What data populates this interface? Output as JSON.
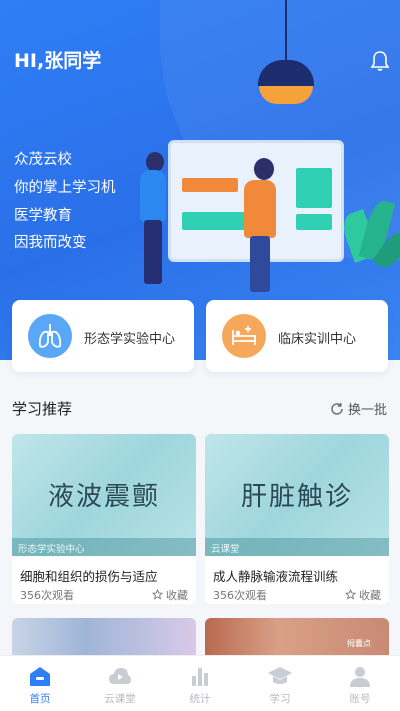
{
  "header": {
    "greeting": "HI,张同学",
    "slogans": [
      "众茂云校",
      "你的掌上学习机",
      "医学教育",
      "因我而改变"
    ]
  },
  "quick_entries": [
    {
      "label": "形态学实验中心",
      "icon": "lungs-icon"
    },
    {
      "label": "临床实训中心",
      "icon": "hospital-bed-icon"
    }
  ],
  "recommend": {
    "title": "学习推荐",
    "refresh_label": "换一批",
    "cards": [
      {
        "thumb_title": "液波震颤",
        "tag": "形态学实验中心",
        "title": "细胞和组织的损伤与适应",
        "views": "356次观看",
        "fav_label": "收藏"
      },
      {
        "thumb_title": "肝脏触诊",
        "tag": "云课堂",
        "title": "成人静脉输液流程训练",
        "views": "356次观看",
        "fav_label": "收藏"
      }
    ],
    "partial_card_text": "拇囊点"
  },
  "tabbar": {
    "items": [
      {
        "label": "首页",
        "icon": "home-icon",
        "active": true
      },
      {
        "label": "云课堂",
        "icon": "cloud-icon",
        "active": false
      },
      {
        "label": "统计",
        "icon": "bar-chart-icon",
        "active": false
      },
      {
        "label": "学习",
        "icon": "graduation-cap-icon",
        "active": false
      },
      {
        "label": "账号",
        "icon": "user-icon",
        "active": false
      }
    ]
  },
  "colors": {
    "primary": "#2f7ef5",
    "accent_orange": "#f08a3a",
    "accent_green": "#2fd0b4"
  }
}
